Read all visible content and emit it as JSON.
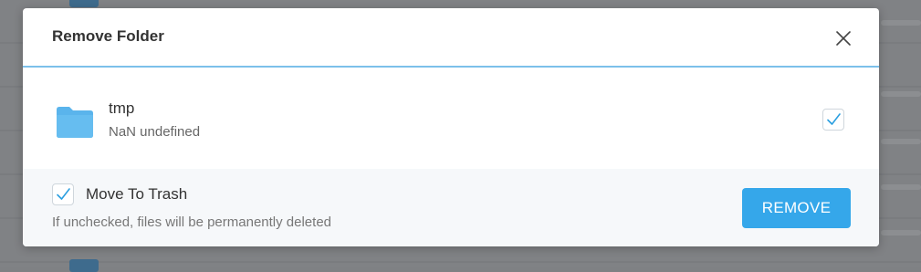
{
  "dialog": {
    "title": "Remove Folder",
    "close_icon": "close-icon"
  },
  "item": {
    "icon": "folder-icon",
    "name": "tmp",
    "meta": "NaN undefined",
    "checked": true
  },
  "footer": {
    "move_to_trash": {
      "label": "Move To Trash",
      "checked": true,
      "hint": "If unchecked, files will be permanently deleted"
    },
    "remove_button": "REMOVE"
  },
  "colors": {
    "accent": "#35a7ea",
    "folder": "#5ab4ec",
    "header_border": "#7cc0ea",
    "check": "#2b9fe0"
  }
}
